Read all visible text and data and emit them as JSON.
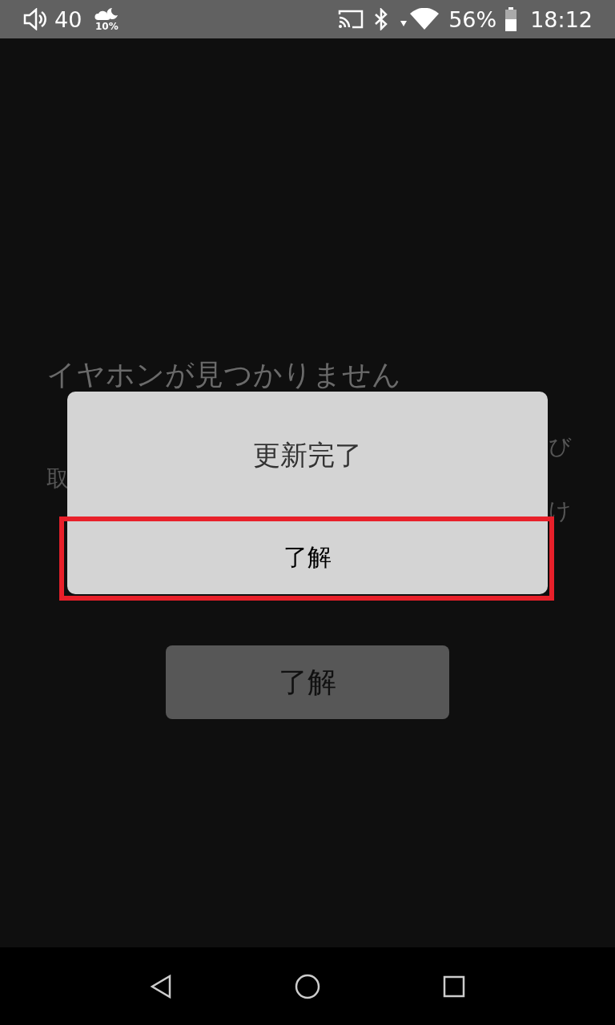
{
  "status_bar": {
    "volume": "40",
    "weather": "10%",
    "battery": "56%",
    "time": "18:12"
  },
  "background": {
    "heading": "イヤホンが見つかりません",
    "note_lines": [
      {
        "right": "び"
      },
      {
        "left": "取"
      },
      {
        "right": "け"
      }
    ],
    "button": "了解"
  },
  "dialog": {
    "title": "更新完了",
    "button": {
      "label": "了解",
      "highlighted": true
    }
  }
}
